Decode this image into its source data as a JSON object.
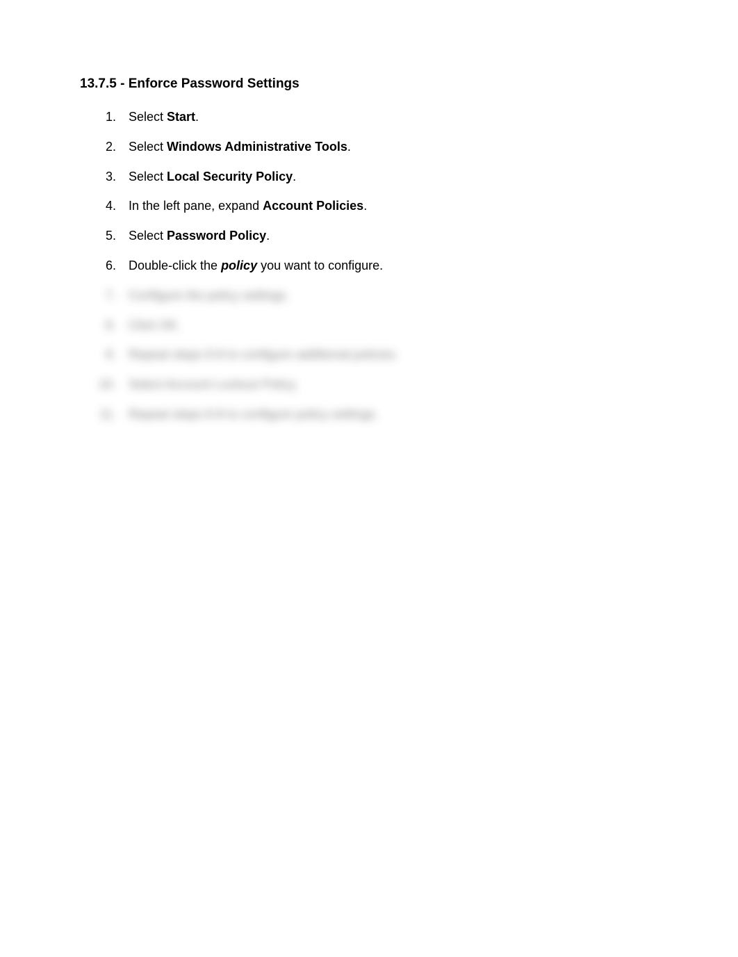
{
  "heading": "13.7.5 - Enforce Password Settings",
  "steps": {
    "s1": {
      "num": "1.",
      "a": "Select ",
      "b": "Start",
      "c": "."
    },
    "s2": {
      "num": "2.",
      "a": "Select ",
      "b": "Windows Administrative Tools",
      "c": "."
    },
    "s3": {
      "num": "3.",
      "a": "Select ",
      "b": "Local Security Policy",
      "c": "."
    },
    "s4": {
      "num": "4.",
      "a": "In the left pane, expand ",
      "b": "Account Policies",
      "c": "."
    },
    "s5": {
      "num": "5.",
      "a": "Select ",
      "b": "Password Policy",
      "c": "."
    },
    "s6": {
      "num": "6.",
      "a": "Double-click the ",
      "b": "policy",
      "c": " you want to configure."
    },
    "s7": {
      "num": "7.",
      "text": "Configure the policy settings."
    },
    "s8": {
      "num": "8.",
      "text": "Click OK."
    },
    "s9": {
      "num": "9.",
      "text": "Repeat steps 6-8 to configure additional policies."
    },
    "s10": {
      "num": "10.",
      "text": "Select Account Lockout Policy."
    },
    "s11": {
      "num": "11.",
      "text": "Repeat steps 6-8 to configure policy settings."
    }
  }
}
